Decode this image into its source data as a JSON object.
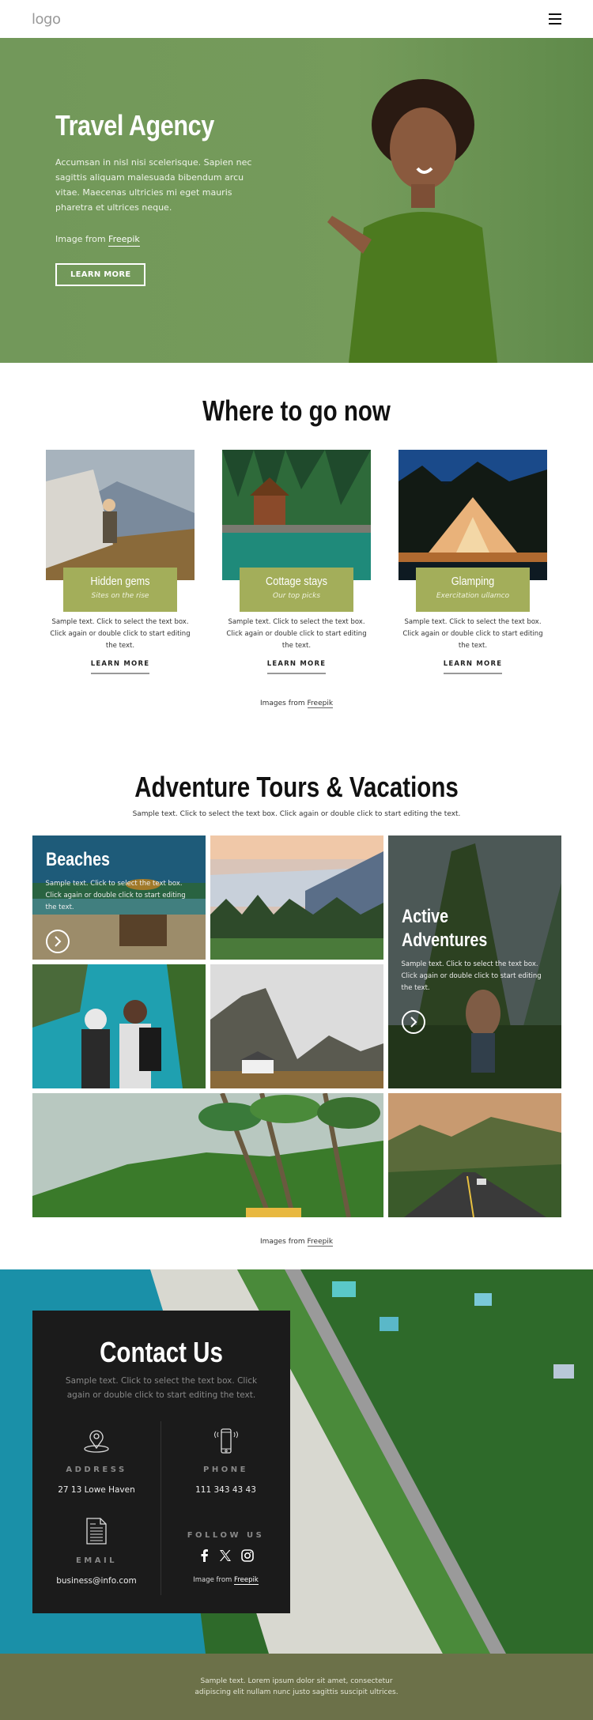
{
  "header": {
    "logo": "logo",
    "menu_icon": "hamburger-menu-icon"
  },
  "hero": {
    "title": "Travel Agency",
    "description": "Accumsan in nisl nisi scelerisque. Sapien nec sagittis aliquam malesuada bibendum arcu vitae. Maecenas ultricies mi eget mauris pharetra et ultrices neque.",
    "credit_prefix": "Image from",
    "credit_link": "Freepik",
    "button": "LEARN MORE",
    "bg_color": "#759b5b"
  },
  "where": {
    "title": "Where to go now",
    "cards": [
      {
        "title": "Hidden gems",
        "subtitle": "Sites on the rise",
        "description": "Sample text. Click to select the text box. Click again or double click to start editing the text.",
        "link": "LEARN MORE"
      },
      {
        "title": "Cottage stays",
        "subtitle": "Our top picks",
        "description": "Sample text. Click to select the text box. Click again or double click to start editing the text.",
        "link": "LEARN MORE"
      },
      {
        "title": "Glamping",
        "subtitle": "Exercitation ullamco",
        "description": "Sample text. Click to select the text box. Click again or double click to start editing the text.",
        "link": "LEARN MORE"
      }
    ],
    "credit_prefix": "Images from",
    "credit_link": "Freepik",
    "label_color": "#a3ae5a"
  },
  "adventure": {
    "title": "Adventure Tours & Vacations",
    "subtitle": "Sample text. Click to select the text box. Click again or double click to start editing the text.",
    "tiles": [
      {
        "title": "Beaches",
        "description": "Sample text. Click to select the text box. Click again or double click to start editing the text."
      },
      {
        "title_line1": "Active",
        "title_line2": "Adventures",
        "description": "Sample text. Click to select the text box. Click again or double click to start editing the text."
      }
    ],
    "credit_prefix": "Images from",
    "credit_link": "Freepik"
  },
  "contact": {
    "title": "Contact Us",
    "description": "Sample text. Click to select the text box. Click again or double click to start editing the text.",
    "address_label": "ADDRESS",
    "address_value": "27 13 Lowe Haven",
    "phone_label": "PHONE",
    "phone_value": "111 343 43 43",
    "email_label": "EMAIL",
    "email_value": "business@info.com",
    "follow_label": "FOLLOW US",
    "credit_prefix": "Image from",
    "credit_link": "Freepik"
  },
  "footer": {
    "text_line1": "Sample text. Lorem ipsum dolor sit amet, consectetur",
    "text_line2": "adipiscing elit nullam nunc justo sagittis suscipit ultrices.",
    "bg_color": "#6c7149"
  }
}
